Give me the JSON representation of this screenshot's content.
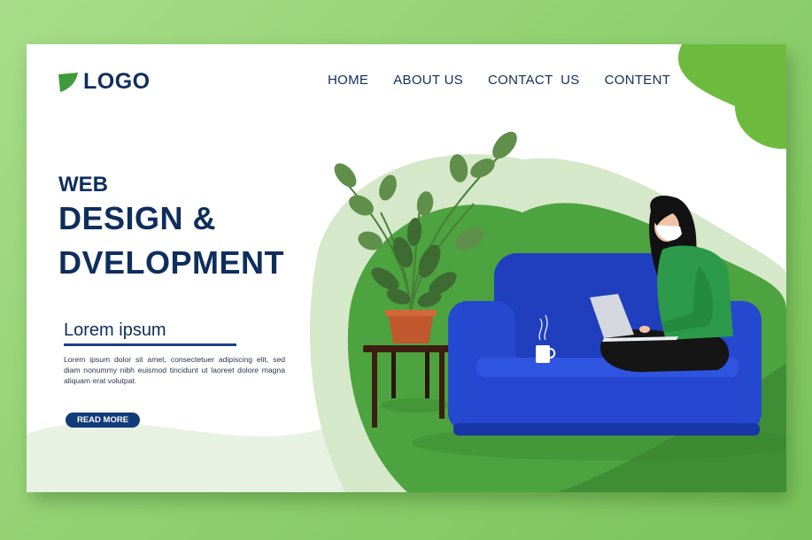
{
  "brand": {
    "logo_text": "LOGO",
    "logo_icon": "leaf-icon"
  },
  "nav": {
    "items": [
      {
        "label": "HOME"
      },
      {
        "label": "ABOUT US"
      },
      {
        "label": "CONTACT  US"
      },
      {
        "label": "CONTENT"
      }
    ]
  },
  "hero": {
    "line1": "WEB",
    "line2": "DESIGN &",
    "line3": "DVELOPMENT"
  },
  "section": {
    "title": "Lorem ipsum",
    "body": "Lorem ipsum dolor sit amet, consectetuer adipiscing elit, sed diam nonummy nibh euismod tincidunt ut laoreet dolore magna aliquam erat volutpat.",
    "cta_label": "READ MORE"
  },
  "colors": {
    "navy": "#0f2e5c",
    "green": "#3f9a3a",
    "light_green": "#cfe6c2",
    "sofa_blue": "#1f46c8",
    "shirt_green": "#2c9a4a"
  }
}
